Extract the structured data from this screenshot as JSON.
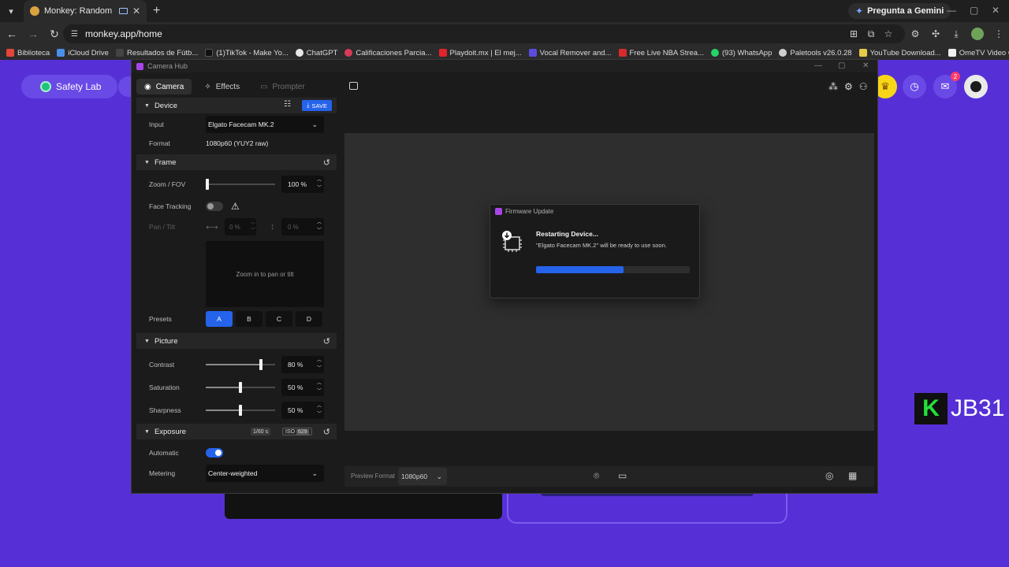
{
  "browser": {
    "tab_title": "Monkey: Random Video Ch",
    "new_tab": "+",
    "url": "monkey.app/home",
    "gemini_label": "Pregunta a Gemini",
    "bookmarks": [
      {
        "label": "Biblioteca",
        "color": "#e2453a"
      },
      {
        "label": "iCloud Drive",
        "color": "#4a8fe8"
      },
      {
        "label": "Resultados de Fútb...",
        "color": "#444444"
      },
      {
        "label": "(1)TikTok - Make Yo...",
        "color": "#111111"
      },
      {
        "label": "ChatGPT",
        "color": "#e8e8e8"
      },
      {
        "label": "Calificaciones Parcia...",
        "color": "#d83a58"
      },
      {
        "label": "Playdoit.mx | El mej...",
        "color": "#e0242b"
      },
      {
        "label": "Vocal Remover and...",
        "color": "#5b4be0"
      },
      {
        "label": "Free Live NBA Strea...",
        "color": "#d82a2a"
      },
      {
        "label": "(93) WhatsApp",
        "color": "#25d366"
      },
      {
        "label": "Paletools v26.0.28",
        "color": "#cfcfcf"
      },
      {
        "label": "YouTube Download...",
        "color": "#e8c84a"
      },
      {
        "label": "OmeTV Video Chat...",
        "color": "#f0f0f0"
      }
    ]
  },
  "page": {
    "safety_lab": "Safety Lab",
    "notification_count": "2",
    "watermark_k": "K",
    "watermark_text": "JB31"
  },
  "app": {
    "window_title": "Camera Hub",
    "tabs": {
      "camera": "Camera",
      "effects": "Effects",
      "prompter": "Prompter"
    },
    "device": {
      "section": "Device",
      "save_label": "SAVE",
      "input_label": "Input",
      "input_value": "Elgato Facecam MK.2",
      "format_label": "Format",
      "format_value": "1080p60 (YUY2 raw)"
    },
    "frame": {
      "section": "Frame",
      "zoom_label": "Zoom / FOV",
      "zoom_value": "100 %",
      "zoom_fraction": 0.0,
      "face_tracking_label": "Face Tracking",
      "face_tracking_on": false,
      "pan_tilt_label": "Pan / Tilt",
      "pan_value": "0 %",
      "tilt_value": "0 %",
      "pan_area_hint": "Zoom in to pan or tilt",
      "presets_label": "Presets",
      "presets": [
        "A",
        "B",
        "C",
        "D"
      ],
      "active_preset": "A"
    },
    "picture": {
      "section": "Picture",
      "contrast_label": "Contrast",
      "contrast_value": "80 %",
      "contrast_fraction": 0.8,
      "saturation_label": "Saturation",
      "saturation_value": "50 %",
      "saturation_fraction": 0.5,
      "sharpness_label": "Sharpness",
      "sharpness_value": "50 %",
      "sharpness_fraction": 0.5
    },
    "exposure": {
      "section": "Exposure",
      "shutter_chip": "1/60 s",
      "iso_label": "ISO",
      "iso_value": "629",
      "automatic_label": "Automatic",
      "automatic_on": true,
      "metering_label": "Metering",
      "metering_value": "Center-weighted"
    },
    "dialog": {
      "title": "Firmware Update",
      "heading": "Restarting Device...",
      "message": "\"Elgato Facecam MK.2\" will be ready to use soon.",
      "progress": 0.57
    },
    "bottom": {
      "preview_format_label": "Preview Format",
      "preview_format_value": "1080p60"
    },
    "accent": "#2563eb"
  }
}
